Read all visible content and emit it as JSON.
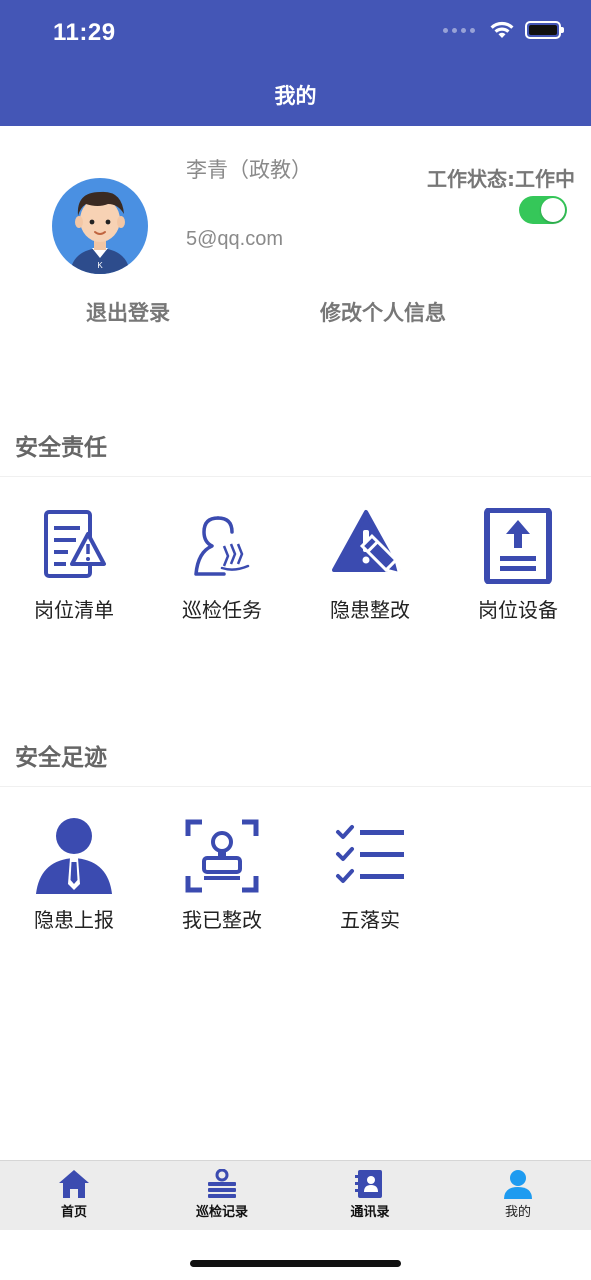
{
  "status_bar": {
    "time": "11:29"
  },
  "header": {
    "title": "我的"
  },
  "profile": {
    "name": "李青（政教）",
    "email": "5@qq.com",
    "work_status_label": "工作状态:工作中",
    "work_status_on": true,
    "logout_label": "退出登录",
    "edit_info_label": "修改个人信息"
  },
  "safety_responsibility": {
    "title": "安全责任",
    "items": [
      {
        "label": "岗位清单",
        "icon": "document-warning-icon"
      },
      {
        "label": "巡检任务",
        "icon": "patrol-person-icon"
      },
      {
        "label": "隐患整改",
        "icon": "warning-pencil-icon"
      },
      {
        "label": "岗位设备",
        "icon": "upload-document-icon"
      }
    ]
  },
  "safety_footprint": {
    "title": "安全足迹",
    "items": [
      {
        "label": "隐患上报",
        "icon": "person-report-icon"
      },
      {
        "label": "我已整改",
        "icon": "stamp-scan-icon"
      },
      {
        "label": "五落实",
        "icon": "checklist-icon"
      }
    ]
  },
  "tabbar": {
    "items": [
      {
        "label": "首页",
        "icon": "home-icon"
      },
      {
        "label": "巡检记录",
        "icon": "patrol-record-icon"
      },
      {
        "label": "通讯录",
        "icon": "contacts-icon"
      },
      {
        "label": "我的",
        "icon": "user-icon"
      }
    ],
    "active_index": 3
  },
  "colors": {
    "header_bg": "#4456b6",
    "icon_primary": "#3b4bb0",
    "toggle_on": "#35c759",
    "tab_active": "#1e9bf0"
  }
}
